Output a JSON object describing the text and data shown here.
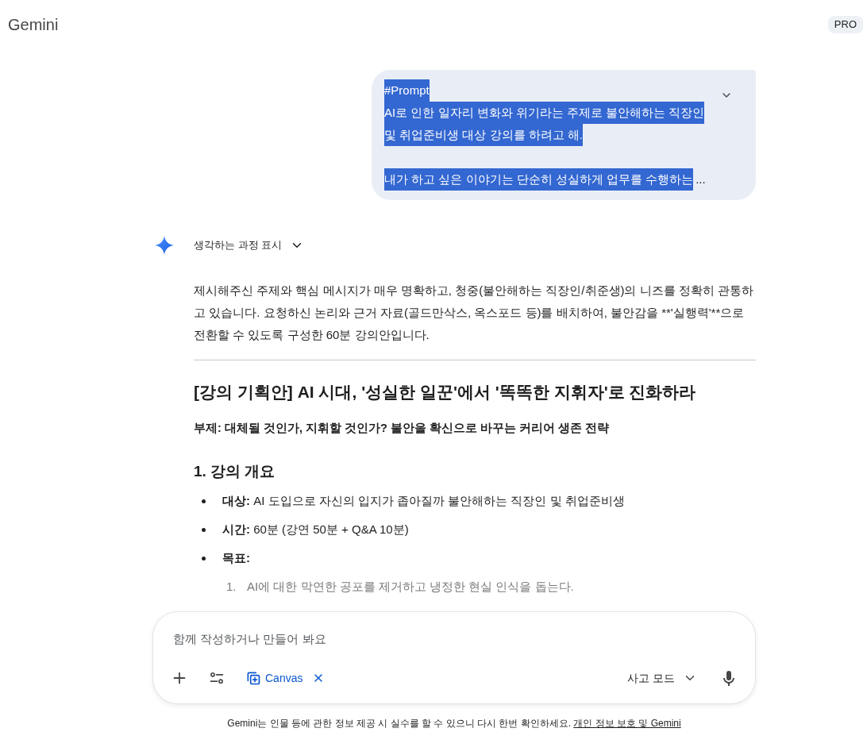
{
  "header": {
    "title": "Gemini",
    "badge": "PRO"
  },
  "user_message": {
    "highlighted": true,
    "expanded": false,
    "paragraphs": [
      [
        "#Prompt",
        "AI로 인한 일자리 변화와 위기라는 주제로 불안해하는 직장인",
        "및 취업준비생 대상 강의를 하려고 해."
      ],
      [
        "내가 하고 싶은 이야기는 단순히 성실하게 업무를 수행하는"
      ]
    ],
    "ellipsis": "..."
  },
  "response": {
    "thinking_toggle": {
      "label": "생각하는 과정 표시",
      "expanded": false
    },
    "intro": "제시해주신 주제와 핵심 메시지가 매우 명확하고, 청중(불안해하는 직장인/취준생)의 니즈를 정확히 관통하고 있습니다. 요청하신 논리와 근거 자료(골드만삭스, 옥스포드 등)를 배치하여, 불안감을 **'실행력'**으로 전환할 수 있도록 구성한 60분 강의안입니다.",
    "title": "[강의 기획안] AI 시대, '성실한 일꾼'에서 '똑똑한 지휘자'로 진화하라",
    "subtitle": "부제: 대체될 것인가, 지휘할 것인가? 불안을 확신으로 바꾸는 커리어 생존 전략",
    "sections": [
      {
        "heading": "1. 강의 개요",
        "items": [
          {
            "label": "대상:",
            "text": "AI 도입으로 자신의 입지가 좁아질까 불안해하는 직장인 및 취업준비생"
          },
          {
            "label": "시간:",
            "text": "60분 (강연 50분 + Q&A 10분)"
          },
          {
            "label": "목표:",
            "children": [
              {
                "number": "1.",
                "text": "AI에 대한 막연한 공포를 제거하고 냉정한 현실 인식을 돕는다."
              }
            ]
          }
        ]
      }
    ]
  },
  "composer": {
    "placeholder": "함께 작성하거나 만들어 봐요",
    "tool_chip": {
      "label": "Canvas",
      "selected": true
    },
    "mode": "사고 모드"
  },
  "footer": {
    "notice": "Gemini는 인물 등에 관한 정보 제공 시 실수를 할 수 있으니 다시 한번 확인하세요.",
    "link": "개인 정보 보호 및 Gemini"
  }
}
